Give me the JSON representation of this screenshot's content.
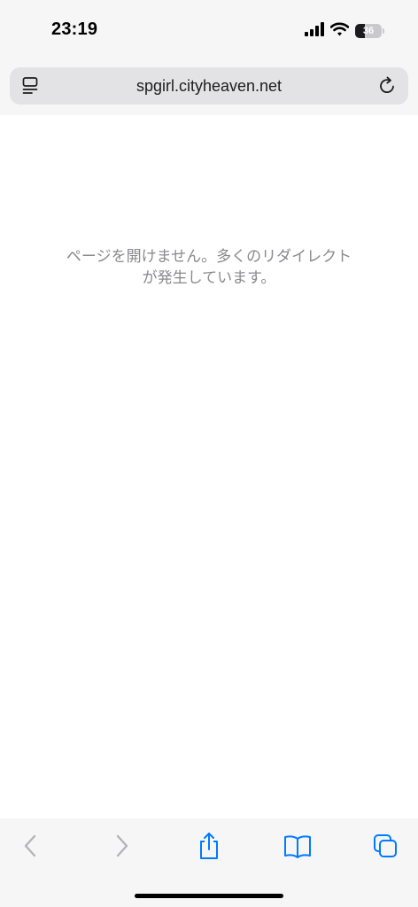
{
  "status_bar": {
    "time": "23:19",
    "battery_level": "36",
    "battery_percent": 36,
    "signal_bars": 4,
    "icons": [
      "signal-icon",
      "wifi-icon",
      "battery-icon"
    ]
  },
  "browser": {
    "url": "spgirl.cityheaven.net",
    "left_icon": "page-menu-icon",
    "right_icon": "reload-icon"
  },
  "content": {
    "error_line1": "ページを開けません。多くのリダイレクト",
    "error_line2": "が発生しています。"
  },
  "toolbar": {
    "items": [
      {
        "name": "back",
        "icon": "chevron-left-icon",
        "enabled": false
      },
      {
        "name": "forward",
        "icon": "chevron-right-icon",
        "enabled": false
      },
      {
        "name": "share",
        "icon": "share-icon",
        "enabled": true
      },
      {
        "name": "bookmarks",
        "icon": "book-icon",
        "enabled": true
      },
      {
        "name": "tabs",
        "icon": "tabs-icon",
        "enabled": true
      }
    ],
    "accent_color": "#007aff",
    "disabled_color": "#b4b4b8"
  }
}
